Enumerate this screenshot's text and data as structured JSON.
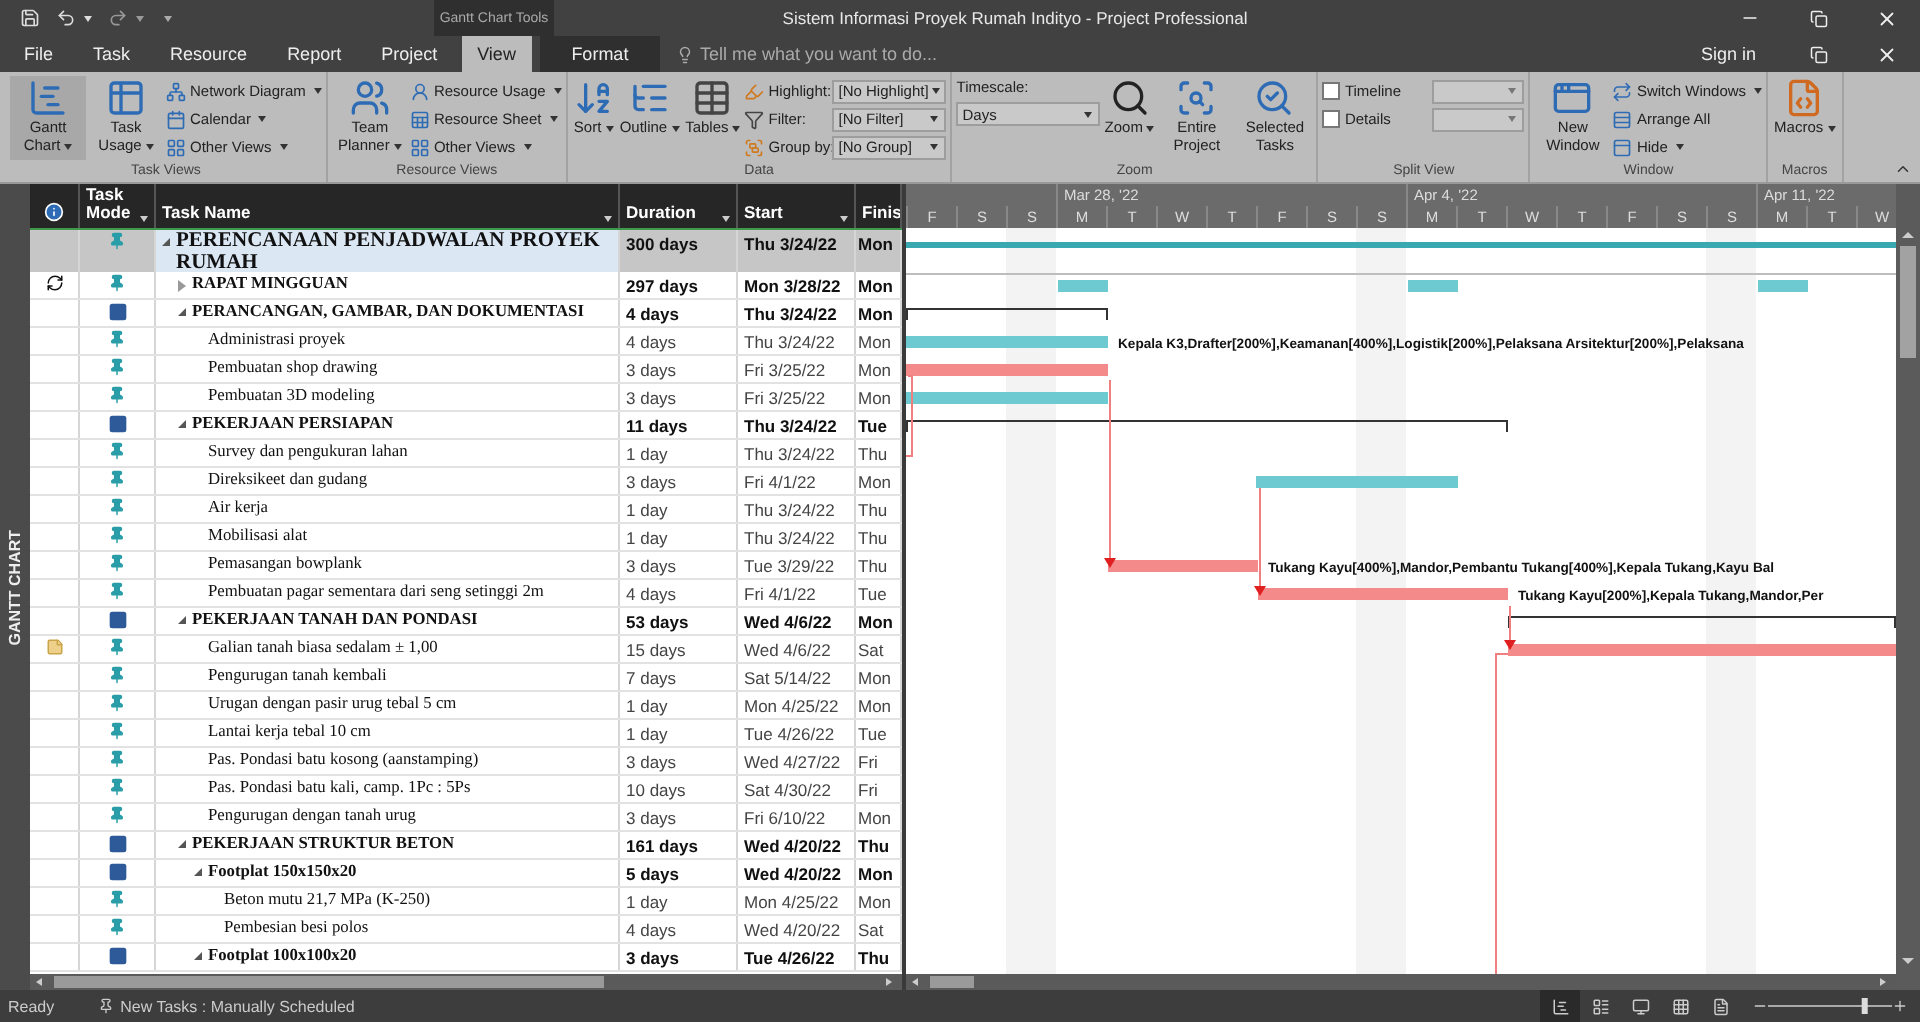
{
  "title_bar": {
    "context_label": "Gantt Chart Tools",
    "title": "Sistem Informasi Proyek Rumah Indityo - Project Professional"
  },
  "ribbon_tabs": [
    {
      "label": "File",
      "selected": false
    },
    {
      "label": "Task",
      "selected": false
    },
    {
      "label": "Resource",
      "selected": false
    },
    {
      "label": "Report",
      "selected": false
    },
    {
      "label": "Project",
      "selected": false
    },
    {
      "label": "View",
      "selected": true
    },
    {
      "label": "Format",
      "selected": false
    }
  ],
  "tell_me": {
    "placeholder": "Tell me what you want to do..."
  },
  "sign_in": "Sign in",
  "ribbon_groups": [
    {
      "label": "Task Views",
      "items": [
        {
          "kind": "large",
          "label": "Gantt Chart",
          "dropdown": true,
          "selected": true
        },
        {
          "kind": "large",
          "label": "Task Usage",
          "dropdown": true,
          "selected": false
        },
        {
          "kind": "stack",
          "items": [
            {
              "kind": "small",
              "label": "Network Diagram",
              "dropdown": true
            },
            {
              "kind": "small",
              "label": "Calendar",
              "dropdown": true
            },
            {
              "kind": "small",
              "label": "Other Views",
              "dropdown": true
            }
          ]
        }
      ]
    },
    {
      "label": "Resource Views",
      "items": [
        {
          "kind": "large",
          "label": "Team Planner",
          "dropdown": true,
          "selected": false
        },
        {
          "kind": "stack",
          "items": [
            {
              "kind": "small",
              "label": "Resource Usage",
              "dropdown": true
            },
            {
              "kind": "small",
              "label": "Resource Sheet",
              "dropdown": true
            },
            {
              "kind": "small",
              "label": "Other Views",
              "dropdown": true
            }
          ]
        }
      ]
    },
    {
      "label": "Data",
      "items": [
        {
          "kind": "large",
          "label": "Sort",
          "dropdown": true
        },
        {
          "kind": "large",
          "label": "Outline",
          "dropdown": true
        },
        {
          "kind": "large",
          "label": "Tables",
          "dropdown": true
        },
        {
          "kind": "stack",
          "items": [
            {
              "kind": "combo",
              "label": "Highlight:",
              "value": "[No Highlight]"
            },
            {
              "kind": "combo",
              "label": "Filter:",
              "value": "[No Filter]"
            },
            {
              "kind": "combo",
              "label": "Group by:",
              "value": "[No Group]"
            }
          ]
        }
      ]
    },
    {
      "label": "Zoom",
      "items": [
        {
          "kind": "field",
          "label": "Timescale:",
          "value": "Days"
        },
        {
          "kind": "large",
          "label": "Zoom",
          "dropdown": true
        },
        {
          "kind": "large",
          "label": "Entire Project"
        },
        {
          "kind": "large",
          "label": "Selected Tasks"
        }
      ]
    },
    {
      "label": "Split View",
      "items": [
        {
          "kind": "stack",
          "items": [
            {
              "kind": "check",
              "label": "Timeline",
              "checked": false
            },
            {
              "kind": "check",
              "label": "Details",
              "checked": false
            }
          ]
        }
      ]
    },
    {
      "label": "Window",
      "items": [
        {
          "kind": "large",
          "label": "New Window"
        },
        {
          "kind": "stack",
          "items": [
            {
              "kind": "small",
              "label": "Switch Windows",
              "dropdown": true
            },
            {
              "kind": "small",
              "label": "Arrange All"
            },
            {
              "kind": "small",
              "label": "Hide",
              "dropdown": true
            }
          ]
        }
      ]
    },
    {
      "label": "Macros",
      "items": [
        {
          "kind": "large",
          "label": "Macros",
          "dropdown": true
        }
      ]
    }
  ],
  "side_label": "GANTT CHART",
  "table": {
    "columns": [
      "Task Mode",
      "Task Name",
      "Duration",
      "Start",
      "Finis"
    ],
    "rows": [
      {
        "name": "PERENCANAAN PENJADWALAN PROYEK RUMAH",
        "duration": "300 days",
        "start": "Thu 3/24/22",
        "finish": "Mon",
        "manual": true,
        "selected": true,
        "expanded": true,
        "children": [
          {
            "kind": "recurring",
            "name": "RAPAT MINGGUAN",
            "duration": "297 days",
            "start": "Mon 3/28/22",
            "finish": "Mon",
            "manual": true,
            "selected": false,
            "expanded": false
          },
          {
            "name": "PERANCANGAN, GAMBAR, DAN DOKUMENTASI",
            "duration": "4 days",
            "start": "Thu 3/24/22",
            "finish": "Mon",
            "manual": false,
            "selected": false,
            "expanded": true,
            "children": [
              {
                "name": "Administrasi proyek",
                "duration": "4 days",
                "start": "Thu 3/24/22",
                "finish": "Mon",
                "manual": true,
                "selected": false,
                "resources": "Kepala K3,Drafter[200%],Keamanan[400%],Logistik[200%],Pelaksana Arsitektur[200%],Pelaksana"
              },
              {
                "name": "Pembuatan shop drawing",
                "duration": "3 days",
                "start": "Fri 3/25/22",
                "finish": "Mon",
                "manual": true,
                "selected": false
              },
              {
                "name": "Pembuatan 3D modeling",
                "duration": "3 days",
                "start": "Fri 3/25/22",
                "finish": "Mon",
                "manual": true,
                "selected": false
              }
            ]
          },
          {
            "name": "PEKERJAAN PERSIAPAN",
            "duration": "11 days",
            "start": "Thu 3/24/22",
            "finish": "Tue",
            "manual": false,
            "selected": false,
            "expanded": true,
            "children": [
              {
                "name": "Survey dan pengukuran lahan",
                "duration": "1 day",
                "start": "Thu 3/24/22",
                "finish": "Thu",
                "manual": true,
                "selected": false
              },
              {
                "name": "Direksikeet dan gudang",
                "duration": "3 days",
                "start": "Fri 4/1/22",
                "finish": "Mon",
                "manual": true,
                "selected": false
              },
              {
                "name": "Air kerja",
                "duration": "1 day",
                "start": "Thu 3/24/22",
                "finish": "Thu",
                "manual": true,
                "selected": false
              },
              {
                "name": "Mobilisasi alat",
                "duration": "1 day",
                "start": "Thu 3/24/22",
                "finish": "Thu",
                "manual": true,
                "selected": false
              },
              {
                "name": "Pemasangan bowplank",
                "duration": "3 days",
                "start": "Tue 3/29/22",
                "finish": "Thu",
                "manual": true,
                "selected": false,
                "resources": "Tukang Kayu[400%],Mandor,Pembantu Tukang[400%],Kepala Tukang,Kayu Bal"
              },
              {
                "name": "Pembuatan pagar sementara dari seng setinggi 2m",
                "duration": "4 days",
                "start": "Fri 4/1/22",
                "finish": "Tue",
                "manual": true,
                "selected": false,
                "resources": "Tukang Kayu[200%],Kepala Tukang,Mandor,Per"
              }
            ]
          },
          {
            "name": "PEKERJAAN TANAH DAN PONDASI",
            "duration": "53 days",
            "start": "Wed 4/6/22",
            "finish": "Mon",
            "manual": false,
            "selected": false,
            "expanded": true,
            "children": [
              {
                "kind": "note",
                "name": "Galian tanah biasa sedalam ± 1,00",
                "duration": "15 days",
                "start": "Wed 4/6/22",
                "finish": "Sat",
                "manual": true,
                "selected": false
              },
              {
                "name": "Pengurugan tanah kembali",
                "duration": "7 days",
                "start": "Sat 5/14/22",
                "finish": "Mon",
                "manual": true,
                "selected": false
              },
              {
                "name": "Urugan dengan pasir urug tebal 5 cm",
                "duration": "1 day",
                "start": "Mon 4/25/22",
                "finish": "Mon",
                "manual": true,
                "selected": false
              },
              {
                "name": "Lantai kerja tebal 10 cm",
                "duration": "1 day",
                "start": "Tue 4/26/22",
                "finish": "Tue",
                "manual": true,
                "selected": false
              },
              {
                "name": "Pas. Pondasi batu kosong (aanstamping)",
                "duration": "3 days",
                "start": "Wed 4/27/22",
                "finish": "Fri",
                "manual": true,
                "selected": false
              },
              {
                "name": "Pas. Pondasi batu kali, camp. 1Pc : 5Ps",
                "duration": "10 days",
                "start": "Sat 4/30/22",
                "finish": "Fri",
                "manual": true,
                "selected": false
              },
              {
                "name": "Pengurugan dengan tanah urug",
                "duration": "3 days",
                "start": "Fri 6/10/22",
                "finish": "Mon",
                "manual": true,
                "selected": false
              }
            ]
          },
          {
            "name": "PEKERJAAN STRUKTUR BETON",
            "duration": "161 days",
            "start": "Wed 4/20/22",
            "finish": "Thu",
            "manual": false,
            "selected": false,
            "expanded": true,
            "children": [
              {
                "name": "Footplat 150x150x20",
                "duration": "5 days",
                "start": "Wed 4/20/22",
                "finish": "Mon",
                "manual": false,
                "selected": false,
                "expanded": true,
                "children": [
                  {
                    "name": "Beton mutu 21,7 MPa (K-250)",
                    "duration": "1 day",
                    "start": "Mon 4/25/22",
                    "finish": "Mon",
                    "manual": true,
                    "selected": false
                  },
                  {
                    "name": "Pembesian besi polos",
                    "duration": "4 days",
                    "start": "Wed 4/20/22",
                    "finish": "Sat",
                    "manual": true,
                    "selected": false
                  }
                ]
              },
              {
                "name": "Footplat 100x100x20",
                "duration": "3 days",
                "start": "Tue 4/26/22",
                "finish": "Thu",
                "manual": false,
                "selected": false,
                "expanded": true
              }
            ]
          }
        ]
      }
    ]
  },
  "timescale": {
    "weeks": [
      "Mar 28, '22",
      "Apr 4, '22",
      "Apr 11, '22"
    ],
    "days": [
      "F",
      "S",
      "S",
      "M",
      "T",
      "W",
      "T",
      "F",
      "S",
      "S",
      "M",
      "T",
      "W",
      "T",
      "F",
      "S",
      "S",
      "M",
      "T",
      "W"
    ]
  },
  "status_bar": {
    "ready": "Ready",
    "new_tasks": "New Tasks : Manually Scheduled",
    "zoom_slider": {
      "level": 0.78
    }
  }
}
